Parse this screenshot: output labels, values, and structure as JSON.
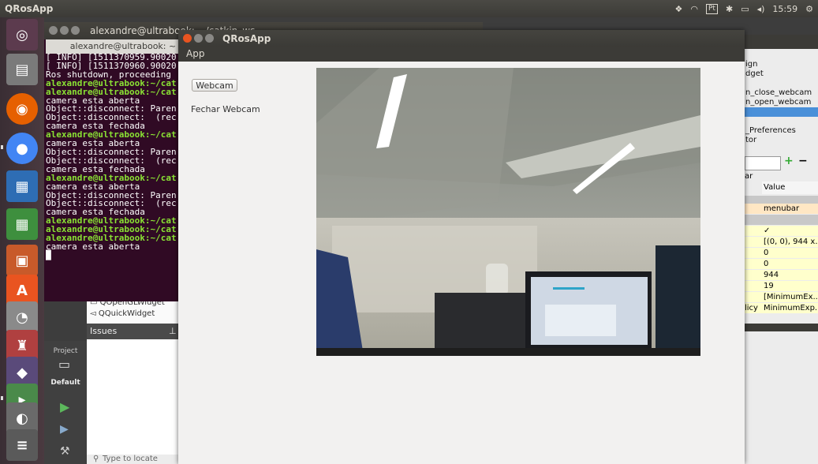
{
  "topbar": {
    "app_title": "QRosApp",
    "keyboard_indicator": "Pt",
    "clock": "15:59"
  },
  "terminal": {
    "title": "alexandre@ultrabook: ~/catkin_ws",
    "tab": "alexandre@ultrabook: ~",
    "lines": [
      {
        "text": "[ INFO] [1511370959.90020",
        "style": "plain"
      },
      {
        "text": "[ INFO] [1511370960.90020",
        "style": "plain"
      },
      {
        "text": "Ros shutdown, proceeding",
        "style": "plain"
      },
      {
        "text": "alexandre@ultrabook:~/cat",
        "style": "prompt"
      },
      {
        "text": "alexandre@ultrabook:~/cat",
        "style": "prompt"
      },
      {
        "text": "camera esta aberta",
        "style": "plain"
      },
      {
        "text": "Object::disconnect: Paren",
        "style": "plain"
      },
      {
        "text": "Object::disconnect:  (rec",
        "style": "plain"
      },
      {
        "text": "camera esta fechada",
        "style": "plain"
      },
      {
        "text": "alexandre@ultrabook:~/cat",
        "style": "prompt"
      },
      {
        "text": "camera esta aberta",
        "style": "plain"
      },
      {
        "text": "Object::disconnect: Paren",
        "style": "plain"
      },
      {
        "text": "Object::disconnect:  (rec",
        "style": "plain"
      },
      {
        "text": "camera esta fechada",
        "style": "plain"
      },
      {
        "text": "alexandre@ultrabook:~/cat",
        "style": "prompt"
      },
      {
        "text": "camera esta aberta",
        "style": "plain"
      },
      {
        "text": "Object::disconnect: Paren",
        "style": "plain"
      },
      {
        "text": "Object::disconnect:  (rec",
        "style": "plain"
      },
      {
        "text": "camera esta fechada",
        "style": "plain"
      },
      {
        "text": "alexandre@ultrabook:~/cat",
        "style": "prompt"
      },
      {
        "text": "alexandre@ultrabook:~/cat",
        "style": "prompt"
      },
      {
        "text": "alexandre@ultrabook:~/cat",
        "style": "prompt"
      },
      {
        "text": "camera esta aberta",
        "style": "plain"
      },
      {
        "text": "█",
        "style": "plain"
      }
    ]
  },
  "ide": {
    "tree_items": [
      "QOpenGLWidget",
      "QQuickWidget"
    ],
    "issues_label": "Issues",
    "project_label": "Project",
    "default_label": "Default",
    "locate_placeholder": "Type to locate"
  },
  "designer_panel": {
    "list_items": [
      "ign",
      "dget",
      "",
      "n_close_webcam",
      "n_open_webcam",
      "",
      "",
      "_Preferences",
      "tor"
    ],
    "property_header": "ar",
    "value_header": "Value",
    "rows": [
      {
        "name": "",
        "value": "menubar"
      },
      {
        "name": "",
        "value": "✓"
      },
      {
        "name": "",
        "value": "[(0, 0), 944 x..."
      },
      {
        "name": "",
        "value": "0"
      },
      {
        "name": "",
        "value": "0"
      },
      {
        "name": "",
        "value": "944"
      },
      {
        "name": "",
        "value": "19"
      },
      {
        "name": "",
        "value": "[MinimumEx..."
      },
      {
        "name": "licy",
        "value": "MinimumExp..."
      }
    ]
  },
  "app": {
    "title": "QRosApp",
    "menu": "App",
    "open_button": "Webcam",
    "close_button": "Fechar Webcam"
  },
  "colors": {
    "terminal_bg": "#300a24",
    "prompt_green": "#8ae234",
    "window_bg": "#f2f1f0",
    "close_red": "#e95420"
  }
}
